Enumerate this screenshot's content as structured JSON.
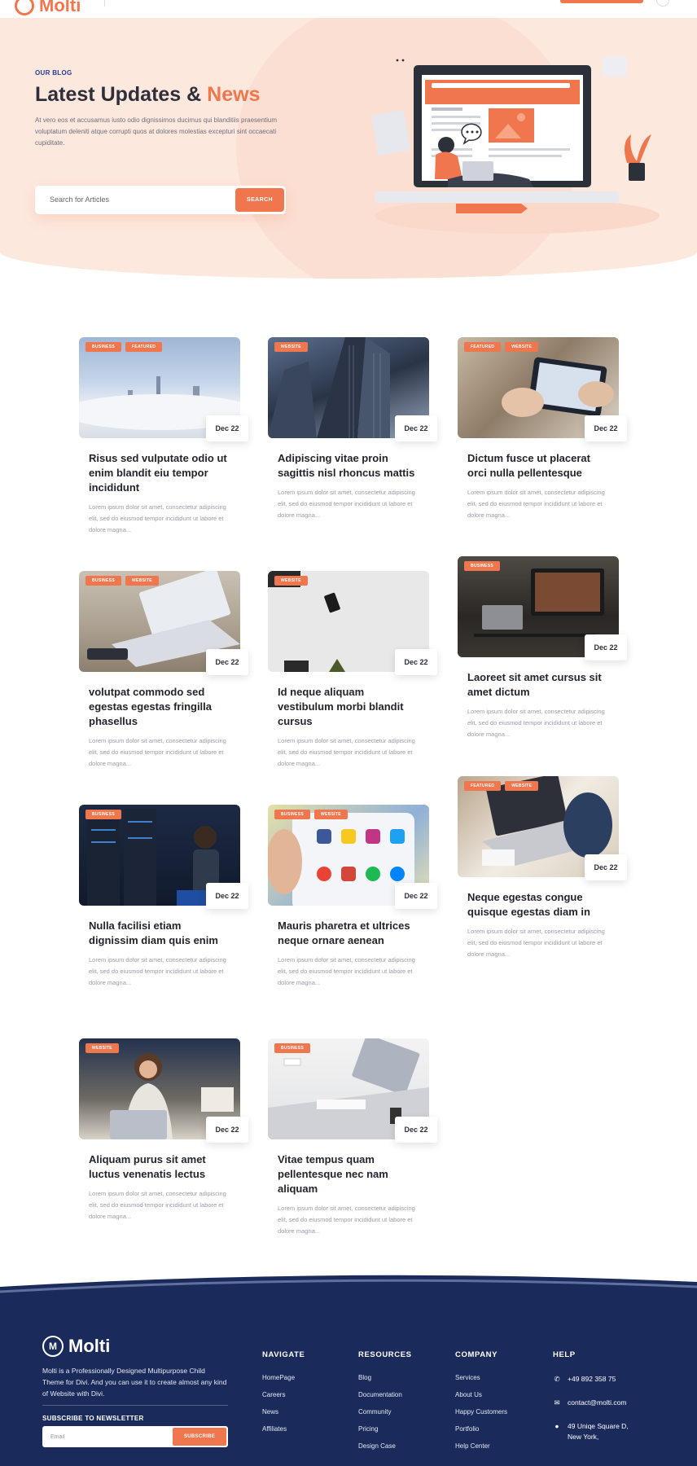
{
  "header": {
    "brand": "Molti"
  },
  "hero": {
    "eyebrow": "OUR BLOG",
    "title_main": "Latest Updates &",
    "title_accent": "News",
    "description": "At vero eos et accusamus iusto odio dignissimos ducimus qui blanditiis praesentium voluptatum deleniti atque corrupti quos at dolores molestias excepturi sint occaecati cupiditate.",
    "search_placeholder": "Search for Articles",
    "search_button": "SEARCH"
  },
  "posts": [
    {
      "title": "Risus sed vulputate odio ut enim blandit eiu tempor incididunt",
      "date": "Dec 22",
      "tags": [
        "BUSINESS",
        "FEATURED"
      ],
      "excerpt": "Lorem ipsum dolor sit amet, consectetur adipiscing elit, sed do eiusmod tempor incididunt ut labore et dolore magna..."
    },
    {
      "title": "Adipiscing vitae proin sagittis nisl rhoncus mattis",
      "date": "Dec 22",
      "tags": [
        "WEBSITE"
      ],
      "excerpt": "Lorem ipsum dolor sit amet, consectetur adipiscing elit, sed do eiusmod tempor incididunt ut labore et dolore magna..."
    },
    {
      "title": "Dictum fusce ut placerat orci nulla pellentesque",
      "date": "Dec 22",
      "tags": [
        "FEATURED",
        "WEBSITE"
      ],
      "excerpt": "Lorem ipsum dolor sit amet, consectetur adipiscing elit, sed do eiusmod tempor incididunt ut labore et dolore magna..."
    },
    {
      "title": "volutpat commodo sed egestas egestas fringilla phasellus",
      "date": "Dec 22",
      "tags": [
        "BUSINESS",
        "WEBSITE"
      ],
      "excerpt": "Lorem ipsum dolor sit amet, consectetur adipiscing elit, sed do eiusmod tempor incididunt ut labore et dolore magna..."
    },
    {
      "title": "Id neque aliquam vestibulum morbi blandit cursus",
      "date": "Dec 22",
      "tags": [
        "WEBSITE"
      ],
      "excerpt": "Lorem ipsum dolor sit amet, consectetur adipiscing elit, sed do eiusmod tempor incididunt ut labore et dolore magna..."
    },
    {
      "title": "Laoreet sit amet cursus sit amet dictum",
      "date": "Dec 22",
      "tags": [
        "BUSINESS"
      ],
      "excerpt": "Lorem ipsum dolor sit amet, consectetur adipiscing elit, sed do eiusmod tempor incididunt ut labore et dolore magna..."
    },
    {
      "title": "Nulla facilisi etiam dignissim diam quis enim",
      "date": "Dec 22",
      "tags": [
        "BUSINESS"
      ],
      "excerpt": "Lorem ipsum dolor sit amet, consectetur adipiscing elit, sed do eiusmod tempor incididunt ut labore et dolore magna..."
    },
    {
      "title": "Mauris pharetra et ultrices neque ornare aenean",
      "date": "Dec 22",
      "tags": [
        "BUSINESS",
        "WEBSITE"
      ],
      "excerpt": "Lorem ipsum dolor sit amet, consectetur adipiscing elit, sed do eiusmod tempor incididunt ut labore et dolore magna..."
    },
    {
      "title": "Neque egestas congue quisque egestas diam in",
      "date": "Dec 22",
      "tags": [
        "FEATURED",
        "WEBSITE"
      ],
      "excerpt": "Lorem ipsum dolor sit amet, consectetur adipiscing elit, sed do eiusmod tempor incididunt ut labore et dolore magna..."
    },
    {
      "title": "Aliquam purus sit amet luctus venenatis lectus",
      "date": "Dec 22",
      "tags": [
        "WEBSITE"
      ],
      "excerpt": "Lorem ipsum dolor sit amet, consectetur adipiscing elit, sed do eiusmod tempor incididunt ut labore et dolore magna..."
    },
    {
      "title": "Vitae tempus quam pellentesque nec nam aliquam",
      "date": "Dec 22",
      "tags": [
        "BUSINESS"
      ],
      "excerpt": "Lorem ipsum dolor sit amet, consectetur adipiscing elit, sed do eiusmod tempor incididunt ut labore et dolore magna..."
    }
  ],
  "footer": {
    "brand": "Molti",
    "about": "Molti is a Professionally Designed  Multipurpose Child Theme for Divi. And you can use it to create almost any kind of Website with Divi.",
    "subscribe_label": "SUBSCRIBE TO NEWSLETTER",
    "email_placeholder": "Email",
    "subscribe_button": "SUBSCRIBE",
    "navigate": {
      "heading": "NAVIGATE",
      "links": [
        "HomePage",
        "Careers",
        "News",
        "Affiliates"
      ]
    },
    "resources": {
      "heading": "RESOURCES",
      "links": [
        "Blog",
        "Documentation",
        "Community",
        "Pricing",
        "Design Case"
      ]
    },
    "company": {
      "heading": "COMPANY",
      "links": [
        "Services",
        "About Us",
        "Happy Customers",
        "Portfolio",
        "Help Center"
      ]
    },
    "help": {
      "heading": "HELP",
      "phone": "+49 892 358 75",
      "email": "contact@molti.com",
      "address_line1": "49 Uniqe Square D,",
      "address_line2": "New York,"
    }
  },
  "colors": {
    "accent": "#f0764d",
    "footer_bg": "#1a2a5a",
    "hero_bg": "#fde8de"
  }
}
